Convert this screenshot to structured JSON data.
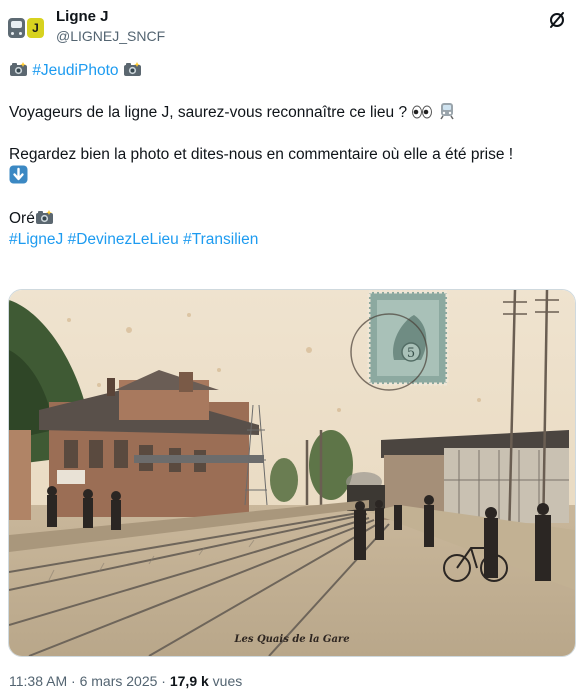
{
  "author": {
    "display_name": "Ligne J",
    "handle": "@LIGNEJ_SNCF",
    "avatar_badge": "J"
  },
  "tweet": {
    "hashtag_photo": "#JeudiPhoto",
    "line1": "Voyageurs de la ligne J, saurez-vous reconnaître ce lieu ?",
    "line2": "Regardez bien la photo et dites-nous en commentaire où elle a été prise !",
    "signature": "Oré",
    "hashtags": [
      "#LigneJ",
      "#DevinezLeLieu",
      "#Transilien"
    ]
  },
  "media": {
    "caption": "Les Quais de la Gare",
    "stamp_value": "5"
  },
  "meta": {
    "time": "11:38 AM",
    "separator": " · ",
    "date": "6 mars 2025",
    "views_count": "17,9 k",
    "views_label": " vues"
  },
  "icons": {
    "grok": "grok-icon",
    "camera": "camera-emoji",
    "eyes": "eyes-emoji",
    "train": "train-emoji",
    "down_arrow": "down-arrow-emoji"
  }
}
